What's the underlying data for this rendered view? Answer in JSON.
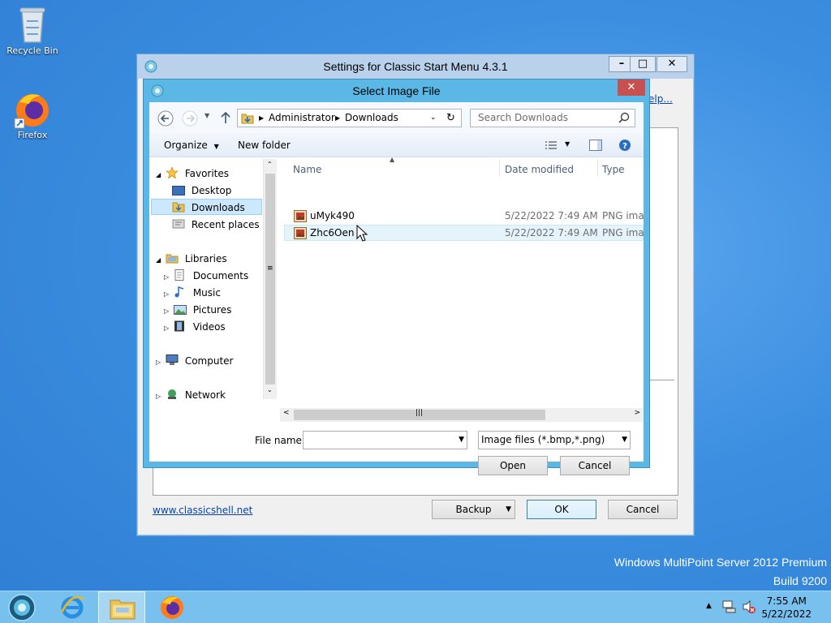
{
  "desktop": {
    "icons": [
      {
        "label": "Recycle Bin",
        "icon": "recycle-bin-icon"
      },
      {
        "label": "Firefox",
        "icon": "firefox-icon"
      }
    ],
    "watermark_line1": "Windows MultiPoint Server 2012 Premium",
    "watermark_line2": "Build 9200"
  },
  "settings_window": {
    "title": "Settings for Classic Start Menu 4.3.1",
    "caption_minimize": "–",
    "caption_maximize": "□",
    "caption_close": "✕",
    "help_link": "elp...",
    "website_link": "www.classicshell.net",
    "backup_label": "Backup",
    "ok_label": "OK",
    "cancel_label": "Cancel"
  },
  "dialog": {
    "title": "Select Image File",
    "close": "✕",
    "address": {
      "segments": [
        "Administrator",
        "Downloads"
      ]
    },
    "search": {
      "placeholder": "Search Downloads"
    },
    "toolbar": {
      "organize": "Organize",
      "new_folder": "New folder"
    },
    "tree": {
      "favorites": "Favorites",
      "desktop": "Desktop",
      "downloads": "Downloads",
      "recent": "Recent places",
      "libraries": "Libraries",
      "documents": "Documents",
      "music": "Music",
      "pictures": "Pictures",
      "videos": "Videos",
      "computer": "Computer",
      "network": "Network"
    },
    "columns": {
      "name": "Name",
      "date": "Date modified",
      "type": "Type"
    },
    "files": [
      {
        "name": "uMyk490",
        "date": "5/22/2022 7:49 AM",
        "type": "PNG image"
      },
      {
        "name": "Zhc6Oen",
        "date": "5/22/2022 7:49 AM",
        "type": "PNG image"
      }
    ],
    "file_name_label": "File name:",
    "file_name_value": "",
    "filter": "Image files (*.bmp,*.png)",
    "open_label": "Open",
    "cancel_label": "Cancel"
  },
  "taskbar": {
    "time": "7:55 AM",
    "date": "5/22/2022"
  }
}
